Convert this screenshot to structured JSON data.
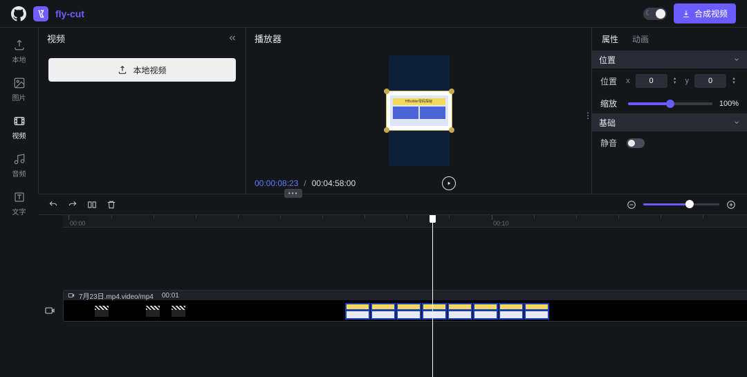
{
  "header": {
    "app_name": "fly-cut",
    "export_label": "合成视频"
  },
  "sidebar": {
    "items": [
      {
        "icon": "upload-icon",
        "label": "本地"
      },
      {
        "icon": "image-icon",
        "label": "图片"
      },
      {
        "icon": "video-icon",
        "label": "视频"
      },
      {
        "icon": "audio-icon",
        "label": "音频"
      },
      {
        "icon": "text-icon",
        "label": "文字"
      }
    ],
    "active_index": 2
  },
  "media_panel": {
    "title": "视频",
    "local_video_btn": "本地视频"
  },
  "player": {
    "title": "播放器",
    "clip_banner_text": "HBuilder零码探秘",
    "current_time": "00:00:08:23",
    "total_time": "00:04:58:00"
  },
  "properties": {
    "tabs": [
      "属性",
      "动画"
    ],
    "active_tab": 0,
    "section_position": "位置",
    "row_position_label": "位置",
    "x_label": "x",
    "x_value": "0",
    "y_label": "y",
    "y_value": "0",
    "scale_label": "缩放",
    "scale_value": "100%",
    "section_basic": "基础",
    "mute_label": "静音"
  },
  "timeline": {
    "ruler_ticks": [
      "00:00",
      "00:10"
    ],
    "clip_name": "7月23日.mp4.video/mp4",
    "clip_duration": "00:01"
  }
}
